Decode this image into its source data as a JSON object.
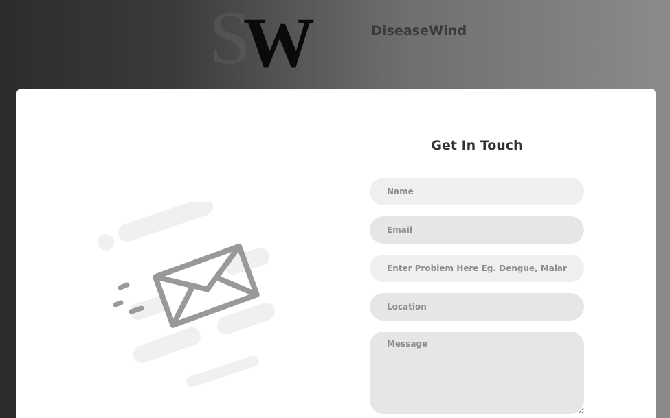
{
  "header": {
    "logo_letters": "SW",
    "brand_name": "DiseaseWind"
  },
  "contact": {
    "title": "Get In Touch",
    "name_placeholder": "Name",
    "email_placeholder": "Email",
    "problem_placeholder": "Enter Problem Here Eg. Dengue, Malaria...",
    "location_placeholder": "Location",
    "message_placeholder": "Message"
  },
  "illustration": {
    "icon": "envelope-icon"
  },
  "colors": {
    "card_background": "#ffffff",
    "field_background": "#e6e6e6",
    "illustration_gray": "#9a9a9a",
    "illustration_light": "#f0f0f0"
  }
}
